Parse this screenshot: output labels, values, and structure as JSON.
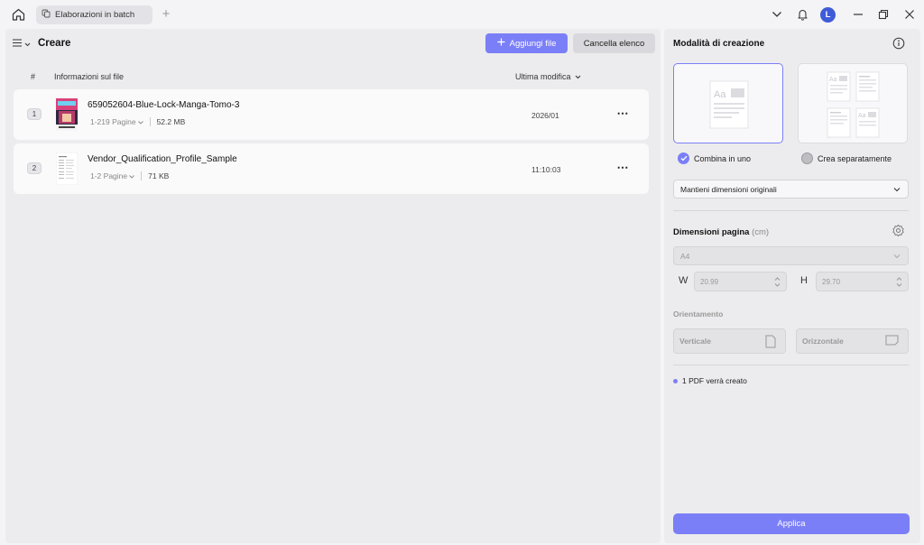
{
  "titlebar": {
    "tab_label": "Elaborazioni in batch",
    "tab_add": "+",
    "avatar_letter": "L"
  },
  "main": {
    "title": "Creare",
    "add_button": "Aggiungi file",
    "clear_button": "Cancella elenco",
    "columns": {
      "index": "#",
      "info": "Informazioni sul file",
      "modified": "Ultima modifica"
    },
    "files": [
      {
        "index": "1",
        "name": "659052604-Blue-Lock-Manga-Tomo-3",
        "pages": "1-219 Pagine",
        "size": "52.2 MB",
        "modified": "2026/01",
        "more": "⋯"
      },
      {
        "index": "2",
        "name": "Vendor_Qualification_Profile_Sample",
        "pages": "1-2 Pagine",
        "size": "71 KB",
        "modified": "11:10:03",
        "more": "⋯"
      }
    ]
  },
  "side": {
    "title": "Modalità di creazione",
    "mode_combine": "Combina in uno",
    "mode_separate": "Crea separatamente",
    "size_select": "Mantieni dimensioni originali",
    "page_dim_title": "Dimensioni pagina",
    "page_dim_unit": "(cm)",
    "paper_select": "A4",
    "width_label": "W",
    "width_value": "20.99",
    "height_label": "H",
    "height_value": "29.70",
    "orientation_title": "Orientamento",
    "portrait": "Verticale",
    "landscape": "Orizzontale",
    "status": "1 PDF verrà creato",
    "apply": "Applica"
  },
  "colors": {
    "accent": "#7b7ff7",
    "avatar": "#3f5bd8"
  }
}
